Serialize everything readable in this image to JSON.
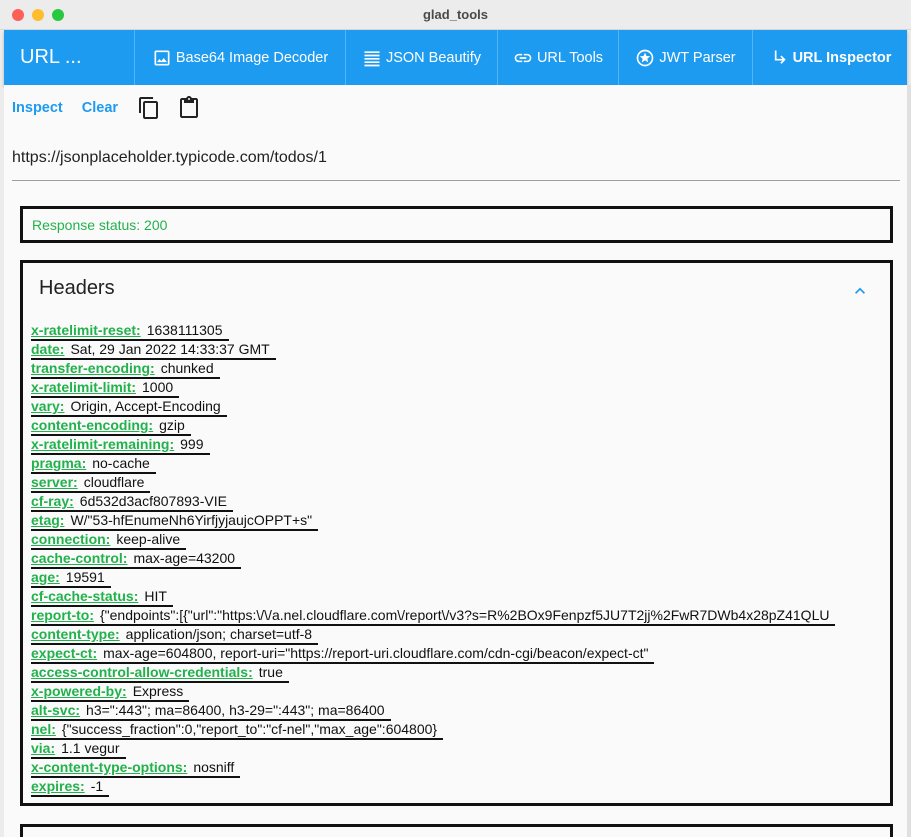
{
  "window": {
    "title": "glad_tools"
  },
  "appbar": {
    "title": "URL ...",
    "tabs": [
      {
        "label": "Base64 Image Decoder",
        "icon": "image-icon"
      },
      {
        "label": "JSON Beautify",
        "icon": "lines-icon"
      },
      {
        "label": "URL Tools",
        "icon": "link-icon"
      },
      {
        "label": "JWT Parser",
        "icon": "star-circle-icon"
      },
      {
        "label": "URL Inspector",
        "icon": "turn-right-arrow-icon",
        "active": true
      }
    ]
  },
  "toolbar": {
    "inspect_label": "Inspect",
    "clear_label": "Clear"
  },
  "url_input": {
    "value": "https://jsonplaceholder.typicode.com/todos/1"
  },
  "status": {
    "text": "Response status: 200"
  },
  "headers": {
    "title": "Headers",
    "items": [
      {
        "key": "x-ratelimit-reset:",
        "value": "1638111305"
      },
      {
        "key": "date:",
        "value": "Sat, 29 Jan 2022 14:33:37 GMT"
      },
      {
        "key": "transfer-encoding:",
        "value": "chunked"
      },
      {
        "key": "x-ratelimit-limit:",
        "value": "1000"
      },
      {
        "key": "vary:",
        "value": "Origin, Accept-Encoding"
      },
      {
        "key": "content-encoding:",
        "value": "gzip"
      },
      {
        "key": "x-ratelimit-remaining:",
        "value": "999"
      },
      {
        "key": "pragma:",
        "value": "no-cache"
      },
      {
        "key": "server:",
        "value": "cloudflare"
      },
      {
        "key": "cf-ray:",
        "value": "6d532d3acf807893-VIE"
      },
      {
        "key": "etag:",
        "value": "W/\"53-hfEnumeNh6YirfjyjaujcOPPT+s\""
      },
      {
        "key": "connection:",
        "value": "keep-alive"
      },
      {
        "key": "cache-control:",
        "value": "max-age=43200"
      },
      {
        "key": "age:",
        "value": "19591"
      },
      {
        "key": "cf-cache-status:",
        "value": "HIT"
      },
      {
        "key": "report-to:",
        "value": "{\"endpoints\":[{\"url\":\"https:\\/\\/a.nel.cloudflare.com\\/report\\/v3?s=R%2BOx9Fenpzf5JU7T2jj%2FwR7DWb4x28pZ41QLU"
      },
      {
        "key": "content-type:",
        "value": "application/json; charset=utf-8"
      },
      {
        "key": "expect-ct:",
        "value": "max-age=604800, report-uri=\"https://report-uri.cloudflare.com/cdn-cgi/beacon/expect-ct\""
      },
      {
        "key": "access-control-allow-credentials:",
        "value": "true"
      },
      {
        "key": "x-powered-by:",
        "value": "Express"
      },
      {
        "key": "alt-svc:",
        "value": "h3=\":443\"; ma=86400, h3-29=\":443\"; ma=86400"
      },
      {
        "key": "nel:",
        "value": "{\"success_fraction\":0,\"report_to\":\"cf-nel\",\"max_age\":604800}"
      },
      {
        "key": "via:",
        "value": "1.1 vegur"
      },
      {
        "key": "x-content-type-options:",
        "value": "nosniff"
      },
      {
        "key": "expires:",
        "value": "-1"
      }
    ]
  },
  "colors": {
    "accent": "#1d9bf0",
    "key_green": "#22b24c"
  }
}
